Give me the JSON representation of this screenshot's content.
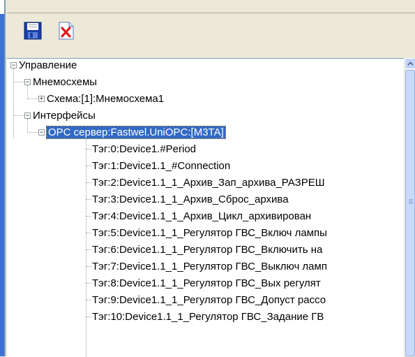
{
  "toolbar": {
    "save_icon": "floppy-disk-icon",
    "delete_icon": "red-x-delete-icon"
  },
  "tree": {
    "root": {
      "label": "Управление"
    },
    "mnemo": {
      "label": "Мнемосхемы"
    },
    "schema": {
      "label": "Схема:[1]:Мнемосхема1"
    },
    "interfaces": {
      "label": "Интерфейсы"
    },
    "opc": {
      "label": "OPC сервер:Fastwel.UniOPC:[M3TA]"
    },
    "tags": [
      "Тэг:0:Device1.#Period",
      "Тэг:1:Device1.1_#Connection",
      "Тэг:2:Device1.1_1_Архив_Зап_архива_РАЗРЕШ",
      "Тэг:3:Device1.1_1_Архив_Сброс_архива",
      "Тэг:4:Device1.1_1_Архив_Цикл_архивирован",
      "Тэг:5:Device1.1_1_Регулятор ГВС_Включ лампы",
      "Тэг:6:Device1.1_1_Регулятор ГВС_Включить на",
      "Тэг:7:Device1.1_1_Регулятор ГВС_Выключ ламп",
      "Тэг:8:Device1.1_1_Регулятор ГВС_Вых регулят",
      "Тэг:9:Device1.1_1_Регулятор ГВС_Допуст рассо",
      "Тэг:10:Device1.1_1_Регулятор ГВС_Задание ГВ"
    ]
  },
  "colors": {
    "selection": "#316ac5",
    "scrollbar": "#c1d3fb"
  }
}
